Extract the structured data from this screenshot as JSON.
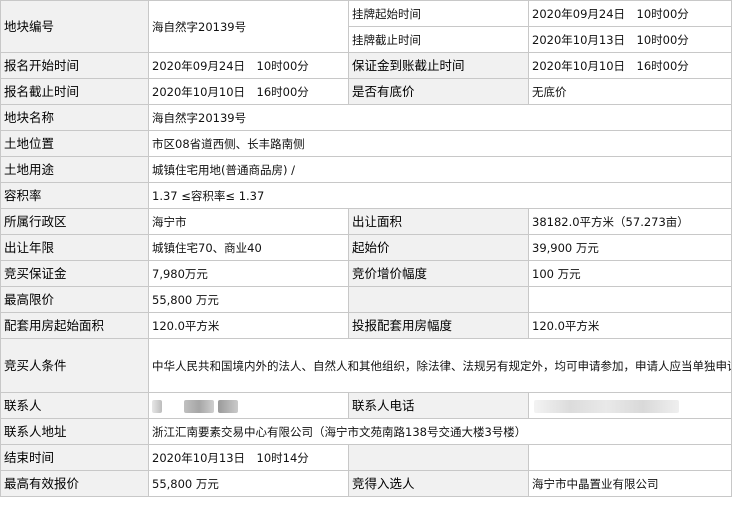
{
  "rows": {
    "r1": {
      "label": "地块编号",
      "value": "海自然字20139号",
      "label_b": "挂牌起始时间",
      "value_b": "2020年09月24日　10时00分"
    },
    "r1b": {
      "label_b": "挂牌截止时间",
      "value_b": "2020年10月13日　10时00分"
    },
    "r2": {
      "label": "报名开始时间",
      "value": "2020年09月24日　10时00分",
      "label_b": "保证金到账截止时间",
      "value_b": "2020年10月10日　16时00分"
    },
    "r3": {
      "label": "报名截止时间",
      "value": "2020年10月10日　16时00分",
      "label_b": "是否有底价",
      "value_b": "无底价"
    },
    "r4": {
      "label": "地块名称",
      "value": "海自然字20139号"
    },
    "r5": {
      "label": "土地位置",
      "value": "市区08省道西侧、长丰路南侧"
    },
    "r6": {
      "label": "土地用途",
      "value": "城镇住宅用地(普通商品房) /"
    },
    "r7": {
      "label": "容积率",
      "value": "1.37 ≤容积率≤ 1.37"
    },
    "r8": {
      "label": "所属行政区",
      "value": "海宁市",
      "label_b": "出让面积",
      "value_b": "38182.0平方米（57.273亩）"
    },
    "r9": {
      "label": "出让年限",
      "value": "城镇住宅70、商业40",
      "label_b": "起始价",
      "value_b": "39,900 万元"
    },
    "r10": {
      "label": "竞买保证金",
      "value": "7,980万元",
      "label_b": "竞价增价幅度",
      "value_b": "100 万元"
    },
    "r11": {
      "label": "最高限价",
      "value": "55,800 万元"
    },
    "r12": {
      "label": "配套用房起始面积",
      "value": "120.0平方米",
      "label_b": "投报配套用房幅度",
      "value_b": "120.0平方米"
    },
    "r13": {
      "label": "竞买人条件",
      "value": "中华人民共和国境内外的法人、自然人和其他组织，除法律、法规另有规定外，均可申请参加，申请人应当单独申请。对缺乏诚信，违反土地管理法律、法规及国有建设用地使用权出让合同，经有关部门教育、督促仍拒不改正者不得参加本次竞买。"
    },
    "r14": {
      "label": "联系人",
      "label_b": "联系人电话"
    },
    "r15": {
      "label": "联系人地址",
      "value": "浙江汇南要素交易中心有限公司（海宁市文苑南路138号交通大楼3号楼）"
    },
    "r16": {
      "label": "结束时间",
      "value": "2020年10月13日　10时14分"
    },
    "r17": {
      "label": "最高有效报价",
      "value": "55,800 万元",
      "label_b": "竞得入选人",
      "value_b": "海宁市中晶置业有限公司"
    }
  }
}
